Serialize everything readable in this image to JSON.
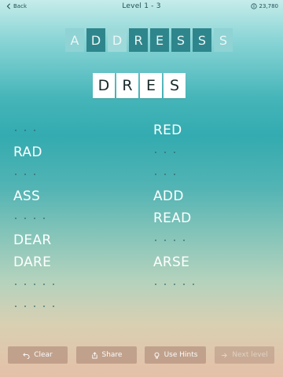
{
  "header": {
    "back_label": "Back",
    "level": "Level 1 - 3",
    "coins": "23,780"
  },
  "source_letters": [
    {
      "char": "A",
      "color": "#8fd3d4"
    },
    {
      "char": "D",
      "color": "#2e868c"
    },
    {
      "char": "D",
      "color": "#9ed9d9"
    },
    {
      "char": "R",
      "color": "#2e868c"
    },
    {
      "char": "E",
      "color": "#2e868c"
    },
    {
      "char": "S",
      "color": "#2e868c"
    },
    {
      "char": "S",
      "color": "#2e868c"
    },
    {
      "char": "S",
      "color": "#8fd3d4"
    }
  ],
  "current_answer": [
    "D",
    "R",
    "E",
    "S"
  ],
  "words_left": [
    {
      "text": "",
      "length": 3
    },
    {
      "text": "RAD",
      "length": 3
    },
    {
      "text": "",
      "length": 3
    },
    {
      "text": "ASS",
      "length": 3
    },
    {
      "text": "",
      "length": 4
    },
    {
      "text": "DEAR",
      "length": 4
    },
    {
      "text": "DARE",
      "length": 4
    },
    {
      "text": "",
      "length": 5
    },
    {
      "text": "",
      "length": 5
    }
  ],
  "words_right": [
    {
      "text": "RED",
      "length": 3
    },
    {
      "text": "",
      "length": 3
    },
    {
      "text": "",
      "length": 3
    },
    {
      "text": "ADD",
      "length": 3
    },
    {
      "text": "READ",
      "length": 4
    },
    {
      "text": "",
      "length": 4
    },
    {
      "text": "ARSE",
      "length": 4
    },
    {
      "text": "",
      "length": 5
    }
  ],
  "buttons": {
    "clear": "Clear",
    "share": "Share",
    "hints": "Use Hints",
    "next": "Next level"
  },
  "colors": {
    "tile_dark": "#2e868c",
    "tile_light": "#8fd3d4",
    "word_found": "#ffffff"
  }
}
